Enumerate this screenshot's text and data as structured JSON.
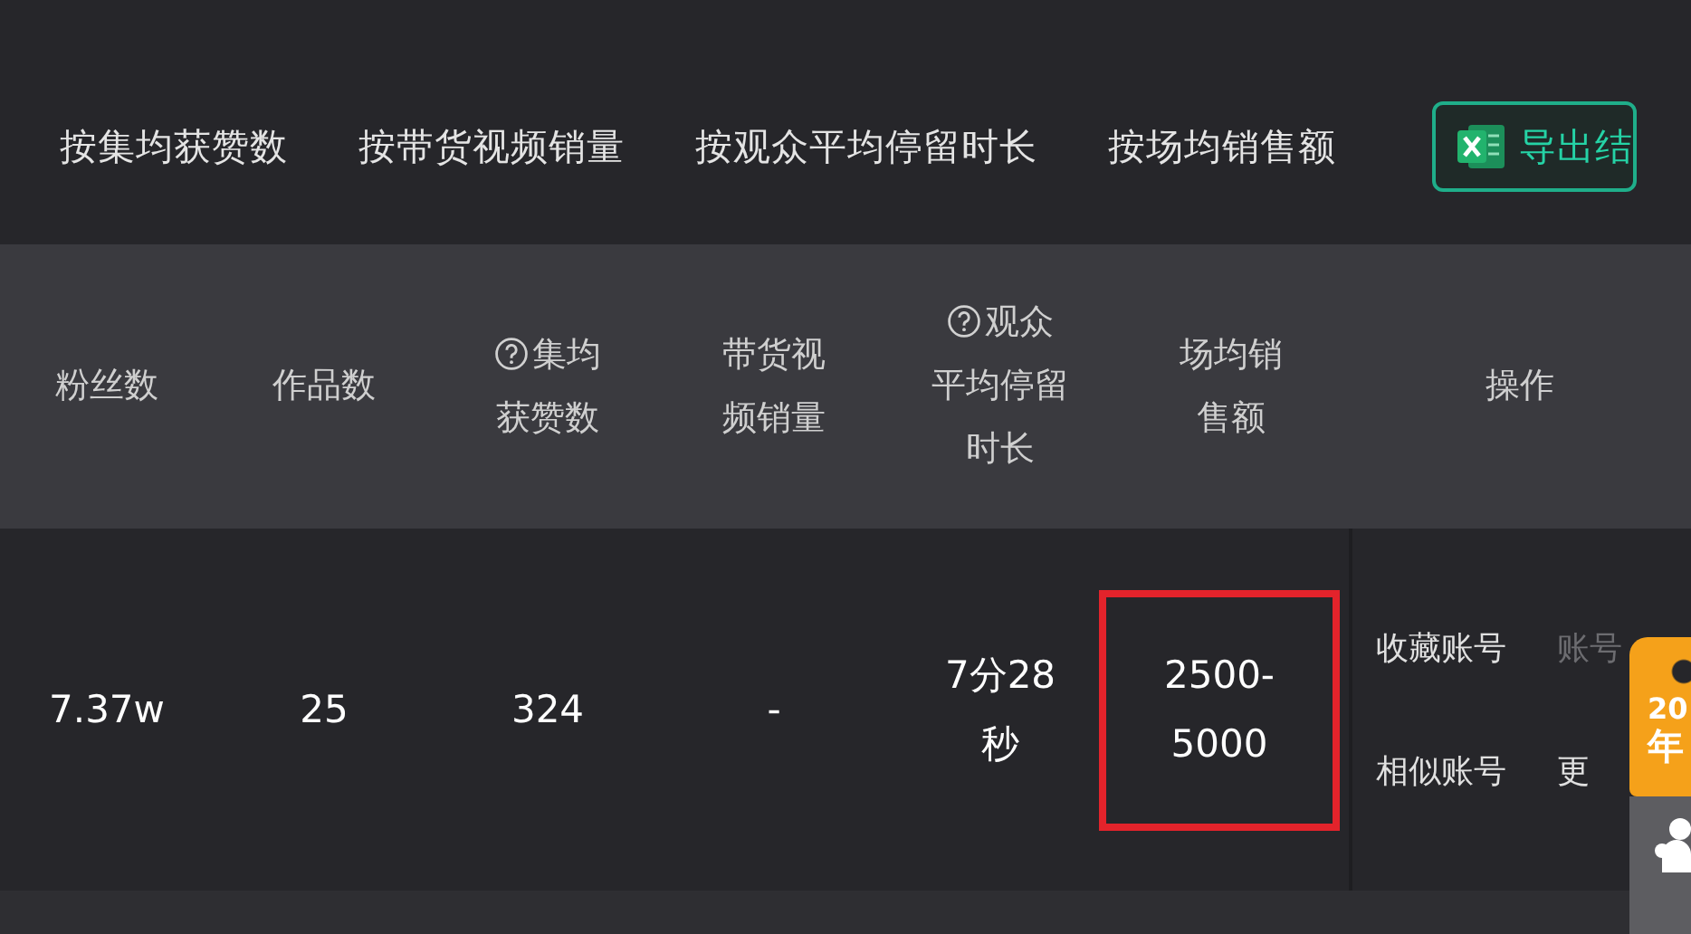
{
  "filters": [
    {
      "label": "按集均获赞数"
    },
    {
      "label": "按带货视频销量"
    },
    {
      "label": "按观众平均停留时长"
    },
    {
      "label": "按场均销售额"
    }
  ],
  "export_button": {
    "label": "导出结"
  },
  "table": {
    "columns": [
      {
        "label": "粉丝数",
        "help": false
      },
      {
        "label": "作品数",
        "help": false
      },
      {
        "label": "集均获赞数",
        "help": true
      },
      {
        "label": "带货视频销量",
        "help": false
      },
      {
        "label": "观众平均停留时长",
        "help": true
      },
      {
        "label": "场均销售额",
        "help": false
      },
      {
        "label": "操作",
        "help": false
      }
    ],
    "rows": [
      {
        "cells": [
          {
            "text": "7.37w",
            "highlighted": false
          },
          {
            "text": "25",
            "highlighted": false
          },
          {
            "text": "324",
            "highlighted": false
          },
          {
            "text": "-",
            "highlighted": false
          },
          {
            "text": "7分28秒",
            "highlighted": false
          },
          {
            "text": "2500-5000",
            "highlighted": true
          }
        ],
        "actions": [
          {
            "label": "收藏账号",
            "disabled": false
          },
          {
            "label": "账号",
            "disabled": true
          },
          {
            "label": "相似账号",
            "disabled": false
          },
          {
            "label": "更",
            "disabled": false
          }
        ]
      }
    ]
  },
  "promo_tag": {
    "lines": [
      "20",
      "年"
    ]
  }
}
